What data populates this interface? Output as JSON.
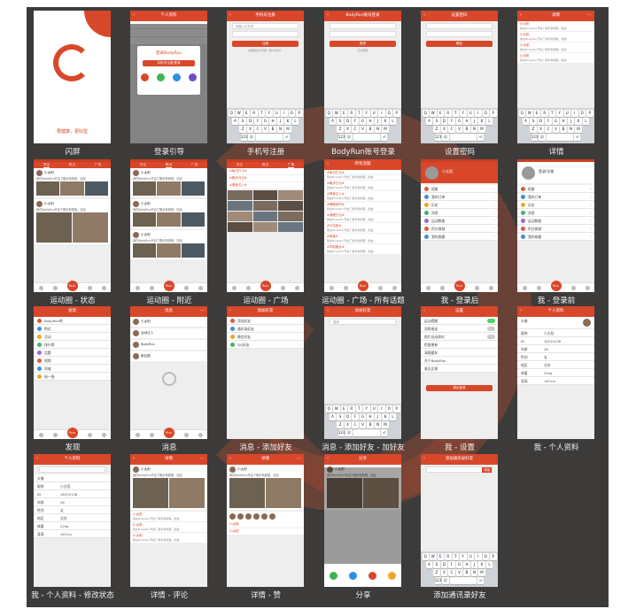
{
  "captions": [
    "闪屏",
    "登录引导",
    "手机号注册",
    "BodyRun账号登录",
    "设置密码",
    "详情",
    "运动圈 - 状态",
    "运动圈 - 附近",
    "运动圈 - 广场",
    "运动圈 - 广场 - 所有话题",
    "我 - 登录后",
    "我 - 登录前",
    "发现",
    "消息",
    "消息 - 添加好友",
    "消息 - 添加好友 - 加好友",
    "我 - 设置",
    "我 - 个人资料",
    "我 - 个人资料 - 修改状态",
    "详情 - 评论",
    "详情 - 赞",
    "分享",
    "添加通讯录好友"
  ],
  "splash": {
    "slogan": "要健康，更好型"
  },
  "login_guide": {
    "header": "个人资料",
    "dialog_title": "登录BodyRun",
    "dialog_btn": "手机号注册/登录"
  },
  "register": {
    "header": "手机号注册",
    "phone_placeholder": "请输入手机号",
    "code_btn": "获取验证码",
    "submit": "注册",
    "agree": "注册即表示同意《用户协议》"
  },
  "account_login": {
    "header": "BodyRun账号登录",
    "submit": "登录",
    "forget": "忘记密码"
  },
  "set_password": {
    "header": "设置密码",
    "submit": "确定"
  },
  "detail": {
    "header": "详情"
  },
  "feed": {
    "tabs": [
      "关注",
      "附近",
      "广场"
    ],
    "user": "小太阳",
    "text": "我在BodyRun开启了跑步新旅程，加油"
  },
  "topics": {
    "header": "所有话题",
    "items": [
      "#每日打卡#",
      "#跑步日记#",
      "#健身达人#",
      "#晒晒身材#",
      "#减肥日记#",
      "#马拉松#",
      "#瑜伽#",
      "#早起跑步#"
    ]
  },
  "me": {
    "name": "小太阳",
    "login_prompt": "登录/注册",
    "items": [
      "相册",
      "我的订单",
      "历史",
      "消息",
      "运动数据",
      "积分商城",
      "我的收藏"
    ]
  },
  "discover": {
    "header": "发现",
    "items": [
      "BodyRun吧",
      "附近",
      "活动",
      "排行榜",
      "话题",
      "视频",
      "同城",
      "摇一摇"
    ]
  },
  "messages": {
    "header": "消息",
    "items": [
      "小太阳",
      "运动达人",
      "BodyRun",
      "跑友圈"
    ]
  },
  "add_friend": {
    "header": "添加好友",
    "items": [
      "添加好友",
      "通讯录好友",
      "微信好友",
      "QQ好友"
    ]
  },
  "search_friend": {
    "header": "添加好友",
    "placeholder": "搜索"
  },
  "settings": {
    "header": "设置",
    "items": [
      "运动提醒",
      "消息推送",
      "图片自动保存",
      "检查更新",
      "清理缓存",
      "关于BodyRun",
      "意见反馈"
    ],
    "logout": "退出登录"
  },
  "profile": {
    "header": "个人资料",
    "rows": [
      [
        "头像",
        ""
      ],
      [
        "昵称",
        "小太阳"
      ],
      [
        "ID",
        "18315138"
      ],
      [
        "年龄",
        "26"
      ],
      [
        "性别",
        "女"
      ],
      [
        "地区",
        "北京"
      ],
      [
        "体重",
        "52kg"
      ],
      [
        "身高",
        "167cm"
      ]
    ]
  },
  "share": {
    "header": "分享"
  },
  "contacts": {
    "header": "添加通讯录好友",
    "btn": "添加"
  },
  "tab": {
    "run": "Run"
  },
  "colors": {
    "brand": "#d9472b",
    "board": "#3d3b3a"
  }
}
